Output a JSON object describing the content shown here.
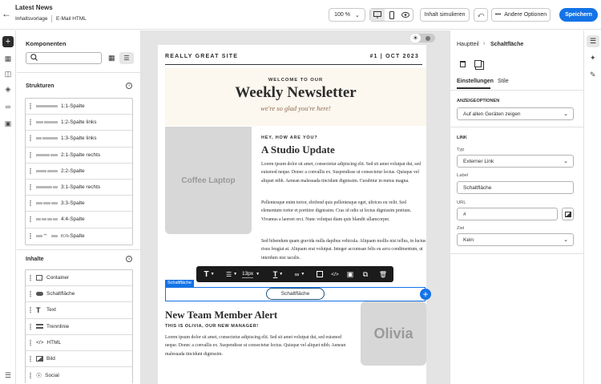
{
  "header": {
    "title": "Latest News",
    "breadcrumb1": "Inhaltsvorlage",
    "breadcrumb2": "E-Mail HTML",
    "zoom": "100 %",
    "simulate": "Inhalt simulieren",
    "more": "Andere Optionen",
    "save": "Speichern"
  },
  "left": {
    "title": "Komponenten",
    "search_placeholder": "",
    "structures_title": "Strukturen",
    "structures": [
      "1:1-Spalte",
      "1:2-Spalte links",
      "1:3-Spalte links",
      "2:1-Spalte rechts",
      "2:2-Spalte",
      "3:1-Spalte rechts",
      "3:3-Spalte",
      "4:4-Spalte",
      "n:n-Spalte"
    ],
    "content_title": "Inhalte",
    "contents": [
      {
        "label": "Container",
        "icon": "container-icon"
      },
      {
        "label": "Schaltfläche",
        "icon": "button-icon"
      },
      {
        "label": "Text",
        "icon": "text-icon"
      },
      {
        "label": "Trennlinie",
        "icon": "divider-icon"
      },
      {
        "label": "HTML",
        "icon": "code-icon"
      },
      {
        "label": "Bild",
        "icon": "image-icon"
      },
      {
        "label": "Social",
        "icon": "social-icon"
      }
    ]
  },
  "doc": {
    "site": "REALLY GREAT SITE",
    "issue": "#1 | OCT 2023",
    "welcome": "WELCOME TO OUR",
    "headline": "Weekly Newsletter",
    "tagline": "we're so glad you're here!",
    "img1": "Coffee Laptop",
    "kicker": "HEY, HOW ARE YOU?",
    "update_title": "A Studio Update",
    "p1": "Lorem ipsum dolor sit amet, consectetur adipiscing elit. Sed sit amet volutpat dui, sed euismod neque. Donec a convallis ex. Suspendisse ut consectetur lectus. Quisque vel aliquet nibh. Aenean malesuada tincidunt dignissim. Curabitur in metus magna.",
    "p2": "Pellentesque enim tortor, eleifend quis pellentesque eget, ultrices eu velit. Sed elementum tortor et porttitor dignissim. Cras id odio ut lectus dignissim pretium. Vivamus a laoreet orci. Nunc volutpat diam quis blandit ullamcorper.",
    "p3": "Sed bibendum quam gravida nulla dapibus vehicula. Aliquam mollis nisi tellus, in luctus risus feugiat at. Aliquam erat volutpat. Integer accumsan felis eu arcu condimentum, ut interdum nisi iaculis.",
    "badge": "Schaltfläche",
    "button": "Schaltfläche",
    "alert_title": "New Team Member Alert",
    "alert_kicker": "THIS IS OLIVIA, OUR NEW MANAGER!",
    "p4": "Lorem ipsum dolor sit amet, consectetur adipiscing elit. Sed sit amet volutpat dui, sed euismod neque. Donec a convallis ex. Suspendisse ut consectetur lectus. Quisque vel aliquet nibh. Aenean malesuada tincidunt dignissim.",
    "img2": "Olivia"
  },
  "toolbar": {
    "fontsize": "13px"
  },
  "right": {
    "crumb_parent": "Hauptteil",
    "crumb_current": "Schaltfläche",
    "tab1": "Einstellungen",
    "tab2": "Stile",
    "display_title": "ANZEIGEOPTIONEN",
    "display_value": "Auf allen Geräten zeigen",
    "link_title": "LINK",
    "type_label": "Typ",
    "type_value": "Externer Link",
    "label_label": "Label",
    "label_value": "Schaltfläche",
    "url_label": "URL",
    "url_value": "#",
    "target_label": "Ziel",
    "target_value": "Kein"
  },
  "colors": {
    "accent": "#1473e6",
    "save": "#1473e6",
    "header_bg": "#fcf7ef"
  }
}
